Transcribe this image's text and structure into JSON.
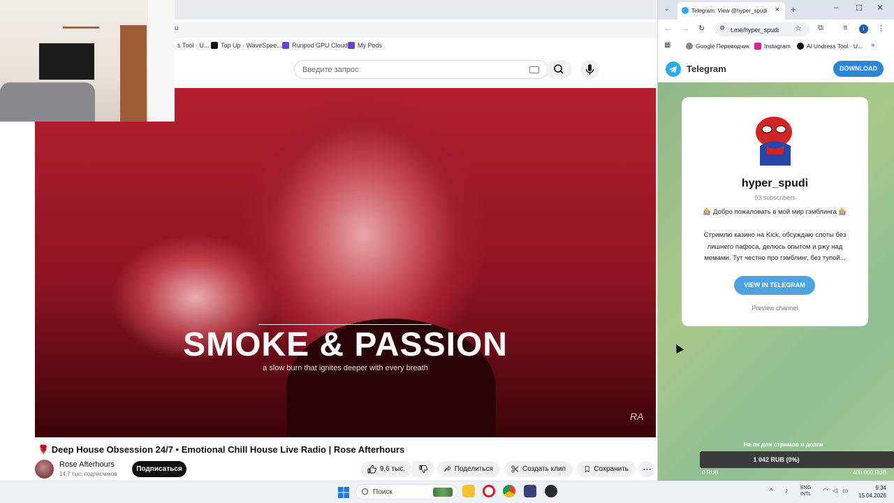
{
  "youtube": {
    "address_fragment": "u",
    "bookmarks": [
      "s Tool · U...",
      "Top Up · WaveSpee...",
      "Runpod GPU Cloud",
      "My Pods"
    ],
    "search_placeholder": "Введите запрос",
    "video": {
      "overlay_title": "SMOKE & PASSION",
      "overlay_subtitle": "a slow burn that ignites deeper with every breath",
      "watermark": "RA",
      "title": "🌹 Deep House Obsession 24/7 • Emotional Chill House Live Radio | Rose Afterhours"
    },
    "channel": {
      "name": "Rose Afterhours",
      "subscribers": "14,7 тыс. подписчиков",
      "subscribe_label": "Подписаться"
    },
    "actions": {
      "likes": "9,6 тыс.",
      "share": "Поделиться",
      "clip": "Создать клип",
      "save": "Сохранить",
      "more": "⋯"
    }
  },
  "telegram_browser": {
    "tab_title": "Telegram: View @hyper_spudi",
    "url": "t.me/hyper_spudi",
    "bookmarks": [
      "Google Переводчик",
      "Instagram",
      "Ai Undress Tool · U..."
    ],
    "header": {
      "brand": "Telegram",
      "download": "DOWNLOAD"
    },
    "card": {
      "name": "hyper_spudi",
      "subscribers": "93 subscribers",
      "welcome": "🎰 Добро пожаловать в мой мир гэмблинга 🎰",
      "desc_lines": [
        "Стримлю казино на Kick, обсуждаю слоты без",
        "лишнего пафоса, делюсь опытом и ржу над",
        "мемами. Тут честно про гэмблинг, без тупой..."
      ],
      "view_button": "VIEW IN TELEGRAM",
      "preview": "Preview channel"
    },
    "donation": {
      "label": "На пк для стримов и долги",
      "current": "1 042 RUB (0%)",
      "min": "0 RUB",
      "max": "400 000 RUB"
    }
  },
  "taskbar": {
    "search_placeholder": "Поиск",
    "lang": [
      "ENG",
      "INTL"
    ],
    "time": "9:34",
    "date": "15.04.2026"
  },
  "colors": {
    "accent_telegram": "#2aabee",
    "youtube_subscribe": "#0f0f0f"
  }
}
